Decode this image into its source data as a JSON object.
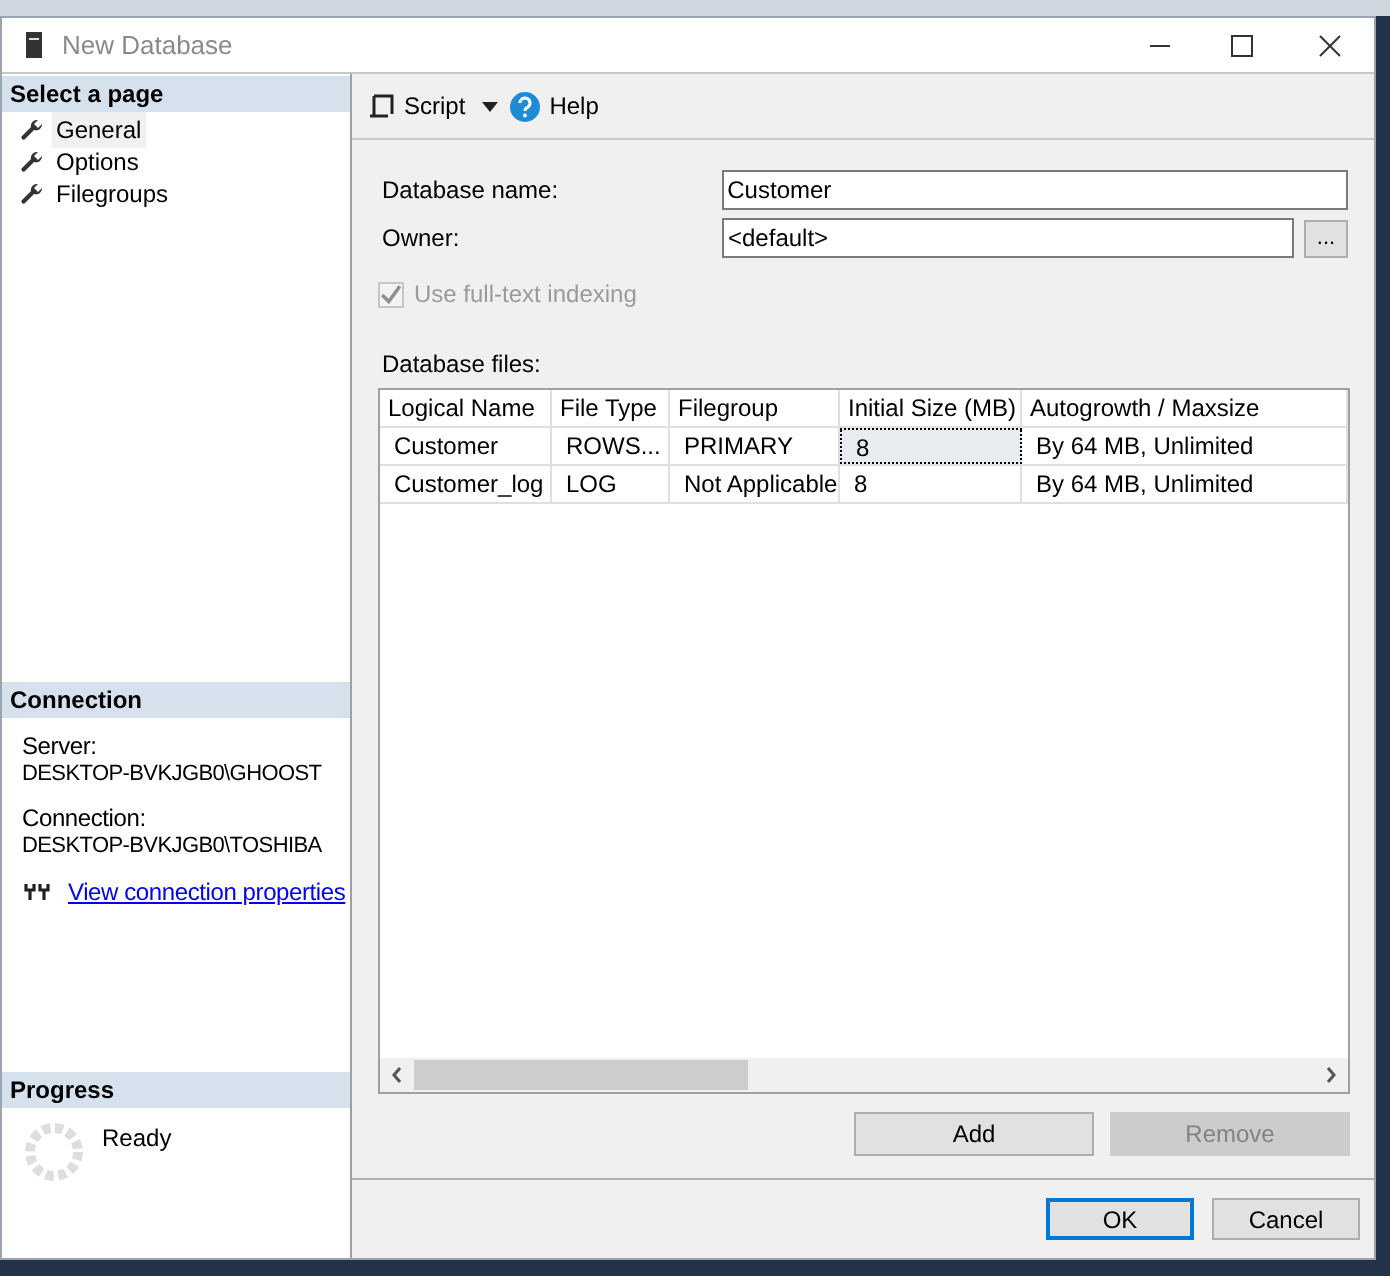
{
  "window": {
    "title": "New Database"
  },
  "sidebar": {
    "header": "Select a page",
    "pages": [
      {
        "label": "General",
        "selected": true
      },
      {
        "label": "Options",
        "selected": false
      },
      {
        "label": "Filegroups",
        "selected": false
      }
    ]
  },
  "connection": {
    "header": "Connection",
    "server_label": "Server:",
    "server": "DESKTOP-BVKJGB0\\GHOOST",
    "connection_label": "Connection:",
    "connection": "DESKTOP-BVKJGB0\\TOSHIBA",
    "link": "View connection properties"
  },
  "progress": {
    "header": "Progress",
    "status": "Ready"
  },
  "toolbar": {
    "script": "Script",
    "help": "Help"
  },
  "form": {
    "name_label": "Database name:",
    "name": "Customer",
    "owner_label": "Owner:",
    "owner": "<default>",
    "browse": "...",
    "fulltext": {
      "label": "Use full-text indexing",
      "checked": true,
      "disabled": true
    }
  },
  "files": {
    "label": "Database files:",
    "columns": [
      "Logical Name",
      "File Type",
      "Filegroup",
      "Initial Size (MB)",
      "Autogrowth / Maxsize"
    ],
    "rows": [
      {
        "cells": [
          {
            "text": "Customer",
            "focused": false
          },
          {
            "text": "ROWS...",
            "focused": false
          },
          {
            "text": "PRIMARY",
            "focused": false
          },
          {
            "text": "8",
            "focused": true
          },
          {
            "text": "By 64 MB, Unlimited",
            "focused": false
          }
        ]
      },
      {
        "cells": [
          {
            "text": "Customer_log",
            "focused": false
          },
          {
            "text": "LOG",
            "focused": false
          },
          {
            "text": "Not Applicable",
            "focused": false
          },
          {
            "text": "8",
            "focused": false
          },
          {
            "text": "By 64 MB, Unlimited",
            "focused": false
          }
        ]
      }
    ]
  },
  "file_buttons": [
    {
      "label": "Add",
      "disabled": false
    },
    {
      "label": "Remove",
      "disabled": true
    }
  ],
  "dialog_buttons": [
    {
      "label": "OK",
      "default": true
    },
    {
      "label": "Cancel",
      "default": false
    }
  ]
}
